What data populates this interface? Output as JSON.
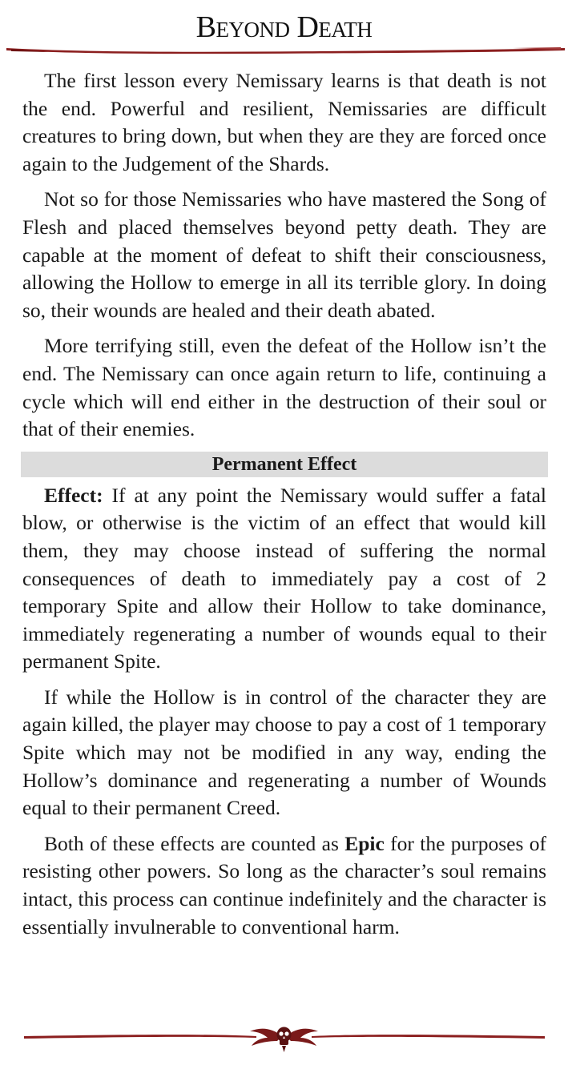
{
  "title": "Beyond Death",
  "paragraphs_intro": [
    "The first lesson every Nemissary learns is that death is not the end. Powerful and resilient, Nemissaries are difficult creatures to bring down, but when they are they are forced once again to the Judgement of the Shards.",
    "Not so for those Nemissaries who have mastered the Song of Flesh and placed themselves beyond petty death. They are capable at the moment of defeat to shift their consciousness, allowing the Hollow to emerge in all its terrible glory. In doing so, their wounds are healed and their death abated.",
    "More terrifying still, even the defeat of the Hollow isn’t the end. The Nemissary can once again return to life, continuing a cycle which will end either in the destruction of their soul or that of their enemies."
  ],
  "section_header": "Permanent Effect",
  "effect": {
    "label": "Effect:",
    "text": " If at any point the Nemissary would suffer a fatal blow, or otherwise is the victim of an effect that would kill them, they may choose instead of suffering the normal consequences of death to immediately pay a cost of 2 temporary Spite and allow their Hollow to take dominance, immediately regenerating a number of wounds equal to their permanent Spite."
  },
  "paragraph_hollow": "If while the Hollow is in control of the character they are again killed, the player may choose to pay a cost of 1 temporary Spite which may not be modified in any way, ending the Hollow’s dominance and regenerating a number of Wounds equal to their permanent Creed.",
  "paragraph_epic": {
    "before": "Both of these effects are counted as ",
    "bold": "Epic",
    "after": " for the purposes of resisting other powers. So long as the character’s soul remains intact, this process can continue indefinitely and the character is essentially invulnerable to conventional harm."
  },
  "colors": {
    "rule": "#8b1e1e",
    "section_bar": "#dcdcdc",
    "text": "#1a1a1a"
  },
  "icons": {
    "footer_ornament": "winged-skull-icon"
  }
}
